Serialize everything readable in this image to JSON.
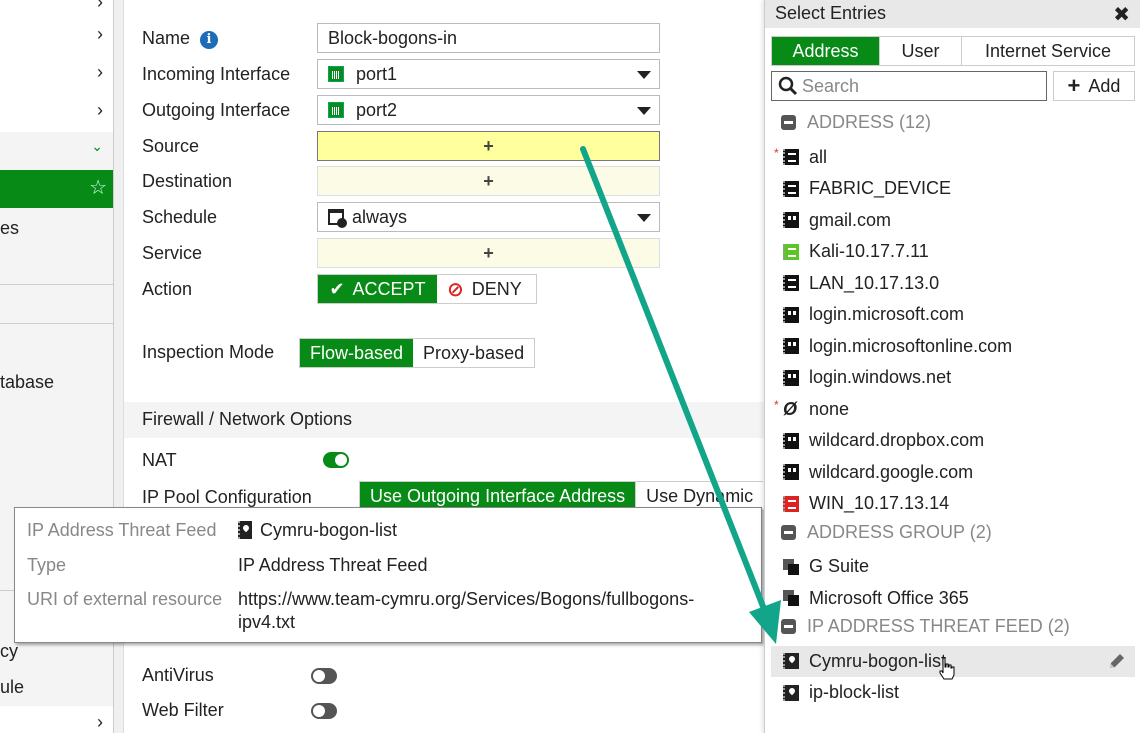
{
  "nav": {
    "partial_labels": [
      "es",
      "tabase",
      "cy",
      "ule"
    ]
  },
  "form": {
    "name_label": "Name",
    "name_value": "Block-bogons-in",
    "incoming_label": "Incoming Interface",
    "incoming_value": "port1",
    "outgoing_label": "Outgoing Interface",
    "outgoing_value": "port2",
    "source_label": "Source",
    "destination_label": "Destination",
    "schedule_label": "Schedule",
    "schedule_value": "always",
    "service_label": "Service",
    "action_label": "Action",
    "action_options": [
      "ACCEPT",
      "DENY"
    ],
    "action_selected": "ACCEPT",
    "plus": "+",
    "inspection_label": "Inspection Mode",
    "inspection_options": [
      "Flow-based",
      "Proxy-based"
    ],
    "inspection_selected": "Flow-based",
    "section_title": "Firewall / Network Options",
    "nat_label": "NAT",
    "nat_enabled": true,
    "ippool_label": "IP Pool Configuration",
    "ippool_options": [
      "Use Outgoing Interface Address",
      "Use Dynamic IP Pool"
    ],
    "ippool_visible_second": "Use Dynamic ",
    "antivirus_label": "AntiVirus",
    "antivirus_enabled": false,
    "webfilter_label": "Web Filter",
    "webfilter_enabled": false
  },
  "tooltip": {
    "rows": [
      {
        "key": "IP Address Threat Feed",
        "value": "Cymru-bogon-list"
      },
      {
        "key": "Type",
        "value": "IP Address Threat Feed"
      },
      {
        "key": "URI of external resource",
        "value": "https://www.team-cymru.org/Services/Bogons/fullbogons-",
        "value2": "ipv4.txt"
      }
    ]
  },
  "panel": {
    "title": "Select Entries",
    "close": "✖",
    "tabs": [
      "Address",
      "User",
      "Internet Service"
    ],
    "active_tab": "Address",
    "search_placeholder": "Search",
    "add_label": "Add",
    "groups": [
      {
        "title": "ADDRESS (12)",
        "items": [
          {
            "name": "all",
            "icon": "address",
            "required": true
          },
          {
            "name": "FABRIC_DEVICE",
            "icon": "address"
          },
          {
            "name": "gmail.com",
            "icon": "fqdn"
          },
          {
            "name": "Kali-10.17.7.11",
            "icon": "address-green"
          },
          {
            "name": "LAN_10.17.13.0",
            "icon": "address"
          },
          {
            "name": "login.microsoft.com",
            "icon": "fqdn"
          },
          {
            "name": "login.microsoftonline.com",
            "icon": "fqdn"
          },
          {
            "name": "login.windows.net",
            "icon": "fqdn"
          },
          {
            "name": "none",
            "icon": "none",
            "required": true
          },
          {
            "name": "wildcard.dropbox.com",
            "icon": "fqdn"
          },
          {
            "name": "wildcard.google.com",
            "icon": "fqdn"
          },
          {
            "name": "WIN_10.17.13.14",
            "icon": "address-red"
          }
        ]
      },
      {
        "title": "ADDRESS GROUP (2)",
        "items": [
          {
            "name": "G Suite",
            "icon": "group"
          },
          {
            "name": "Microsoft Office 365",
            "icon": "group"
          }
        ]
      },
      {
        "title": "IP ADDRESS THREAT FEED (2)",
        "items": [
          {
            "name": "Cymru-bogon-list",
            "icon": "feed",
            "hover": true
          },
          {
            "name": "ip-block-list",
            "icon": "feed"
          }
        ]
      }
    ]
  },
  "colors": {
    "accent": "#078a16",
    "arrow": "#12a58a",
    "highlight_field": "#ffff9e"
  }
}
